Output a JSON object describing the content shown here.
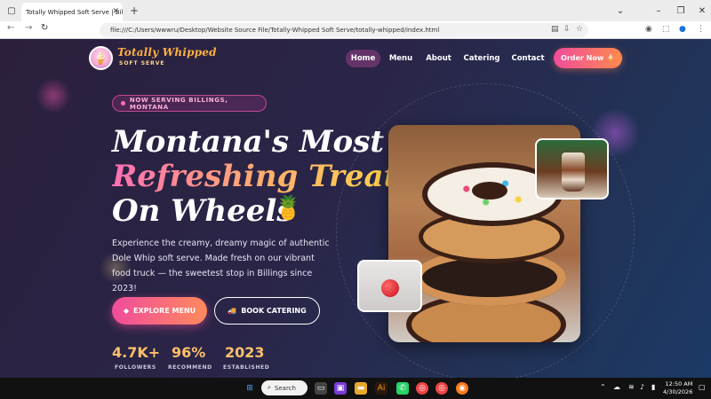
{
  "browser": {
    "tab_title": "Totally Whipped Soft Serve | Billings",
    "url": "file:///C:/Users/wwwru/Desktop/Website Source File/Totally-Whipped Soft Serve/totally-whipped/index.html"
  },
  "brand": {
    "name": "Totally Whipped",
    "tagline": "SOFT SERVE"
  },
  "nav": {
    "items": [
      "Home",
      "Menu",
      "About",
      "Catering",
      "Contact"
    ],
    "active": "Home",
    "cta": "Order Now 🍦"
  },
  "hero": {
    "badge": "NOW SERVING BILLINGS, MONTANA",
    "line1": "Montana's Most",
    "line2": "Refreshing Treat",
    "line3": "On Wheels",
    "emoji": "🍍",
    "description": "Experience the creamy, dreamy magic of authentic Dole Whip soft serve. Made fresh on our vibrant food truck — the sweetest stop in Billings since 2023!",
    "btn_explore": "EXPLORE MENU",
    "btn_catering": "BOOK CATERING"
  },
  "stats": [
    {
      "value": "4.7K+",
      "label": "FOLLOWERS"
    },
    {
      "value": "96%",
      "label": "RECOMMEND"
    },
    {
      "value": "2023",
      "label": "ESTABLISHED"
    }
  ],
  "taskbar": {
    "search": "Search",
    "time": "12:50 AM",
    "date": "4/30/2026"
  },
  "colors": {
    "accent_pink": "#f04c9c",
    "accent_orange": "#ff8a4d",
    "stat_gold": "#ffc06a"
  }
}
